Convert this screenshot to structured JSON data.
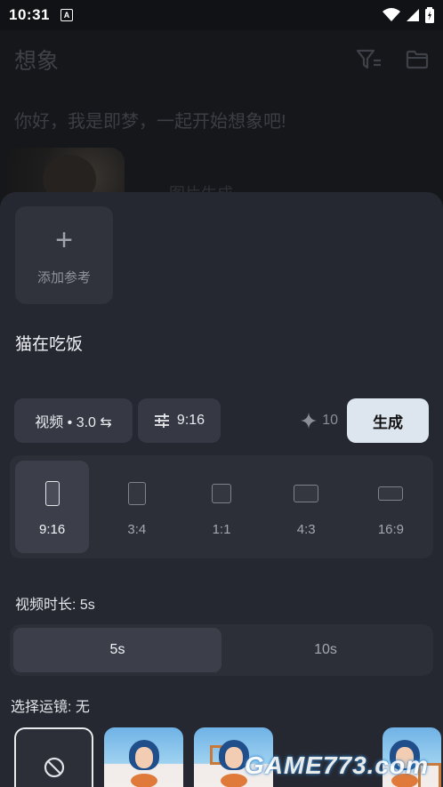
{
  "status": {
    "time": "10:31",
    "notif_badge": "A"
  },
  "background": {
    "title": "想象",
    "greeting": "你好，我是即梦，一起开始想象吧!",
    "caption": "图片生成"
  },
  "sheet": {
    "add_reference_label": "添加参考",
    "prompt": "猫在吃饭",
    "model_chip": "视频 • 3.0 ⇆",
    "ratio_chip": "9:16",
    "credits": "10",
    "generate_label": "生成",
    "ratios": [
      {
        "label": "9:16",
        "selected": true
      },
      {
        "label": "3:4",
        "selected": false
      },
      {
        "label": "1:1",
        "selected": false
      },
      {
        "label": "4:3",
        "selected": false
      },
      {
        "label": "16:9",
        "selected": false
      }
    ],
    "duration_label": "视频时长: 5s",
    "durations": [
      {
        "label": "5s",
        "selected": true
      },
      {
        "label": "10s",
        "selected": false
      }
    ],
    "camera_label": "选择运镜: 无",
    "camera_options": [
      "none-icon",
      "preset-1",
      "preset-2",
      "preset-3",
      "preset-4"
    ]
  },
  "watermark": "GAME773.com",
  "colors": {
    "sheet_bg": "#252831",
    "chip_bg": "#363944",
    "generate_bg": "#dde6ee",
    "selected_bg": "#3c3f4a"
  }
}
